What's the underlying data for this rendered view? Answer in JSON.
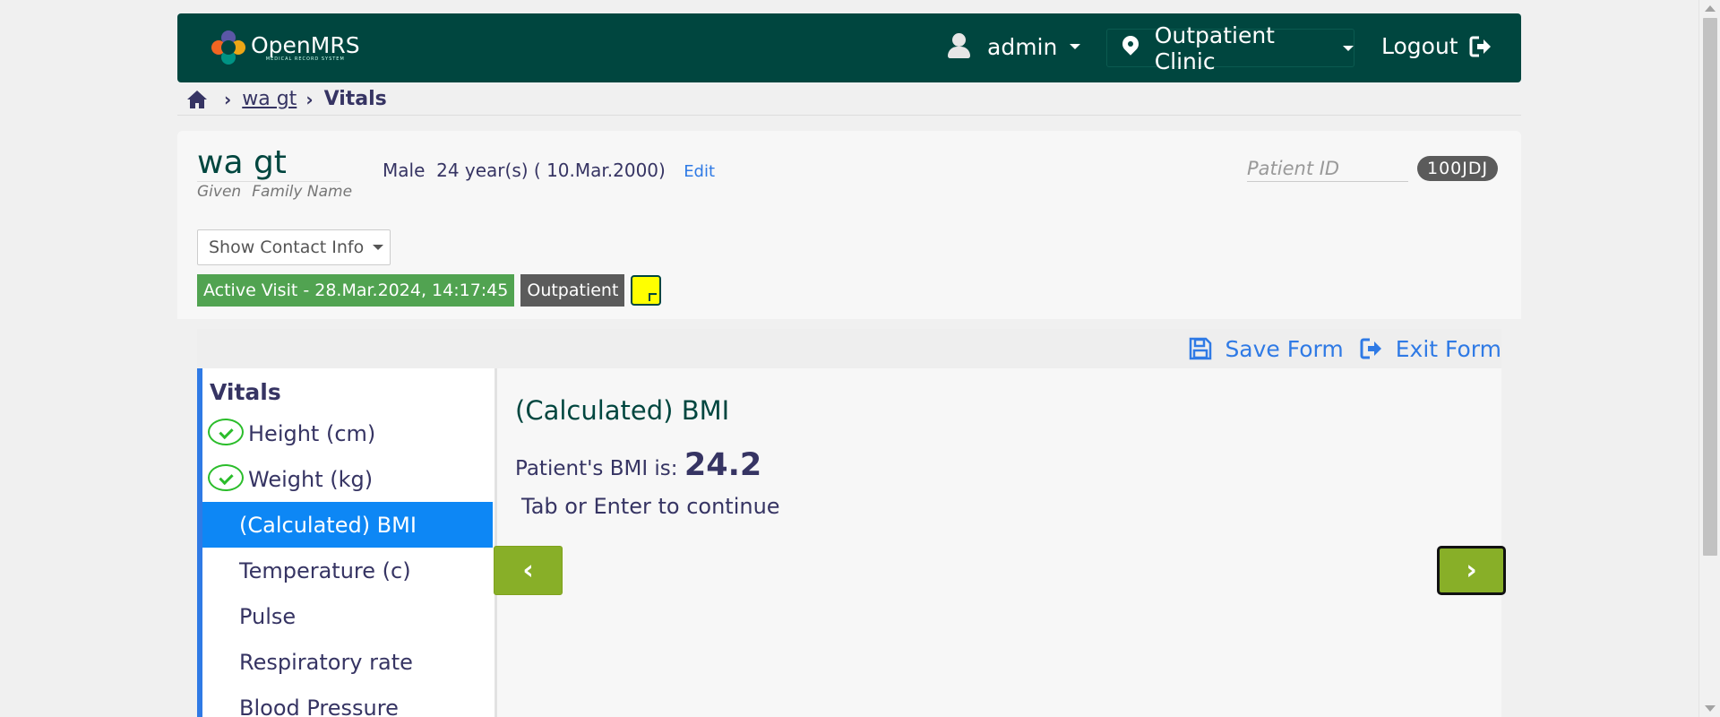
{
  "header": {
    "logo_title": "OpenMRS",
    "logo_subtitle": "MEDICAL RECORD SYSTEM",
    "user_label": "admin",
    "location_label": "Outpatient Clinic",
    "logout_label": "Logout"
  },
  "breadcrumb": {
    "patient_link": "wa gt",
    "current": "Vitals"
  },
  "patient": {
    "name": "wa gt",
    "given_label": "Given",
    "family_label": "Family Name",
    "gender": "Male",
    "age": "24 year(s) ( 10.Mar.2000)",
    "edit_label": "Edit",
    "id_label": "Patient ID",
    "id_value": "100JDJ",
    "contact_button": "Show Contact Info",
    "visit_badge": "Active Visit - 28.Mar.2024, 14:17:45",
    "visit_type_badge": "Outpatient"
  },
  "form": {
    "save_label": "Save Form",
    "exit_label": "Exit Form",
    "nav_title": "Vitals",
    "nav_items": [
      {
        "label": "Height (cm)",
        "done": true
      },
      {
        "label": "Weight (kg)",
        "done": true
      },
      {
        "label": "(Calculated) BMI",
        "active": true
      },
      {
        "label": "Temperature (c)"
      },
      {
        "label": "Pulse"
      },
      {
        "label": "Respiratory rate"
      },
      {
        "label": "Blood Pressure"
      }
    ],
    "question_title": "(Calculated) BMI",
    "bmi_prefix": "Patient's BMI is:",
    "bmi_value": "24.2",
    "hint": "Tab or Enter to continue",
    "prev_symbol": "‹",
    "next_symbol": "›"
  },
  "colors": {
    "header_bg": "#00463f",
    "accent_blue": "#2f7ae5",
    "active_nav": "#0d87f5",
    "visit_green": "#51a351",
    "nav_button_green": "#88af28"
  }
}
